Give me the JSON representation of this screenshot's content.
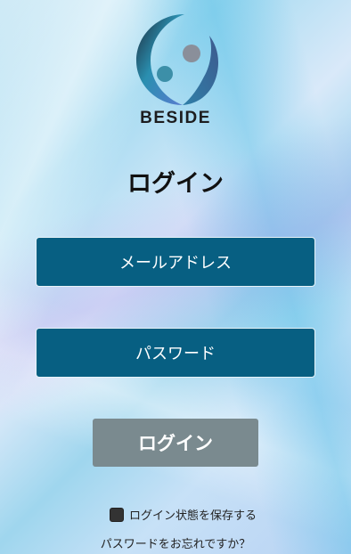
{
  "brand": {
    "name": "BESIDE",
    "logo_icon": "beside-logo-icon"
  },
  "page": {
    "title": "ログイン"
  },
  "form": {
    "email_label": "メールアドレス",
    "password_label": "パスワード",
    "login_button": "ログイン",
    "remember_label": "ログイン状態を保存する",
    "remember_checked": false,
    "forgot_password": "パスワードをお忘れですか？"
  },
  "colors": {
    "field_bg": "#075f82",
    "button_bg": "#7a8a8f",
    "logo_arc": "#2a8fb0",
    "logo_dot_left": "#3c8fa8",
    "logo_dot_right": "#8a8f9a"
  }
}
